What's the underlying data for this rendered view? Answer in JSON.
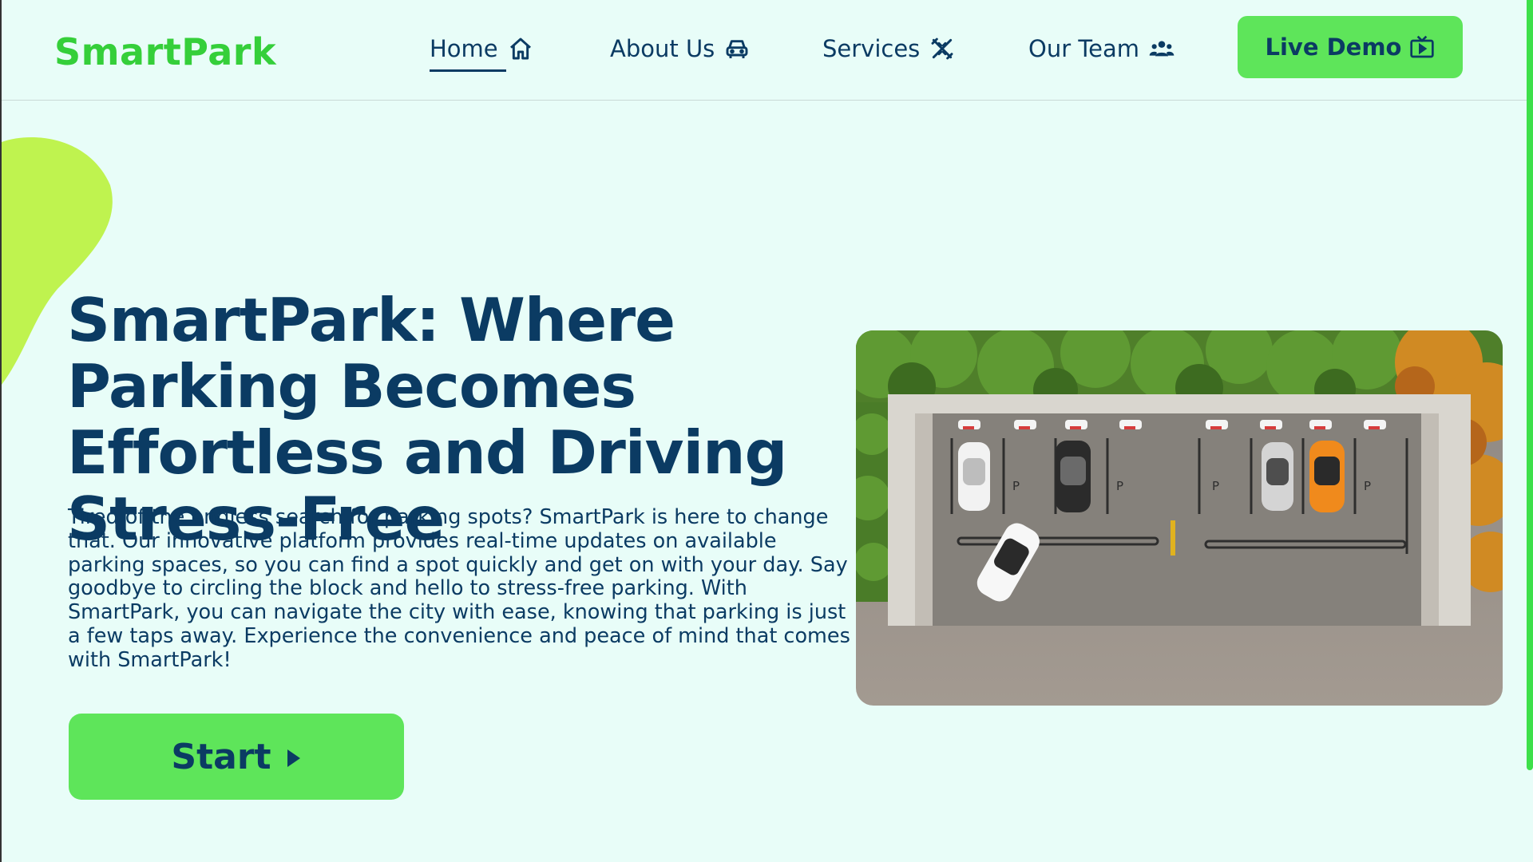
{
  "brand": {
    "name": "SmartPark",
    "accent": "#35cf3a",
    "button_color": "#5ee55a",
    "text_color": "#0b3b63",
    "background": "#e8fdf8"
  },
  "nav": {
    "items": [
      {
        "label": "Home",
        "icon": "home-icon",
        "active": true
      },
      {
        "label": "About Us",
        "icon": "car-icon",
        "active": false
      },
      {
        "label": "Services",
        "icon": "tools-icon",
        "active": false
      },
      {
        "label": "Our Team",
        "icon": "team-icon",
        "active": false
      }
    ],
    "cta_label": "Live Demo",
    "cta_icon": "tv-play-icon"
  },
  "hero": {
    "title": "SmartPark: Where Parking Becomes Effortless and Driving Stress-Free",
    "description": "Tired of the endless search for parking spots? SmartPark is here to change that. Our innovative platform provides real-time updates on available parking spaces, so you can find a spot quickly and get on with your day. Say goodbye to circling the block and hello to stress-free parking. With SmartPark, you can navigate the city with ease, knowing that parking is just a few taps away. Experience the convenience and peace of mind that comes with SmartPark!",
    "start_label": "Start",
    "start_icon": "play-triangle-icon",
    "image": "aerial-parking-lot-image",
    "parking_sign": "P"
  }
}
